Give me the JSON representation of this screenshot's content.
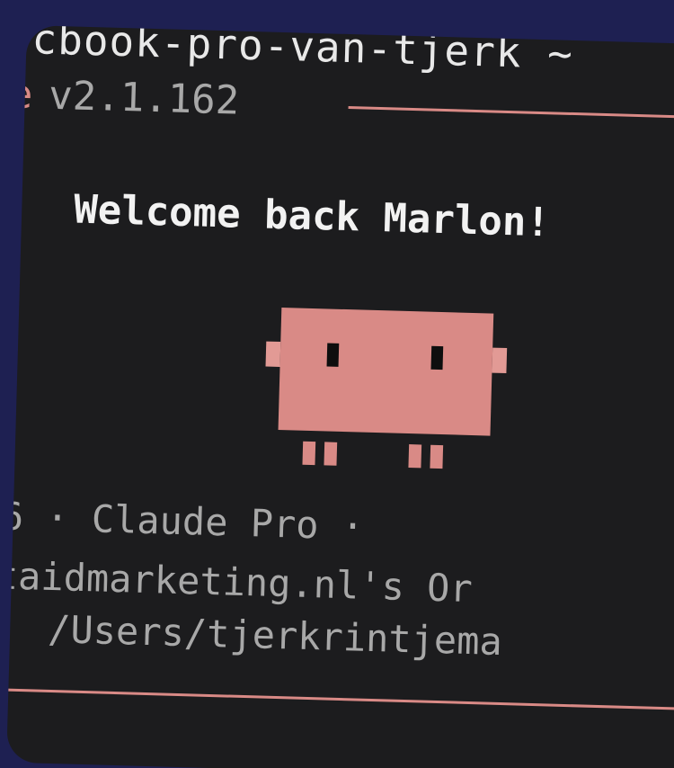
{
  "terminal": {
    "host": "cbook-pro-van-tjerk ~",
    "app_name_fragment": "e",
    "version": "v2.1.162",
    "welcome": "Welcome back Marlon!",
    "info_line_1": "6 · Claude Pro ·",
    "info_line_2": "taidmarketing.nl's Or",
    "info_line_3": "/Users/tjerkrintjema"
  },
  "colors": {
    "background": "#1e2052",
    "terminal_bg": "#1c1c1e",
    "accent": "#d98a86",
    "text_primary": "#f2f2f2",
    "text_dim": "#a8a8a8"
  },
  "mascot": {
    "icon": "pixel-creature-icon"
  }
}
